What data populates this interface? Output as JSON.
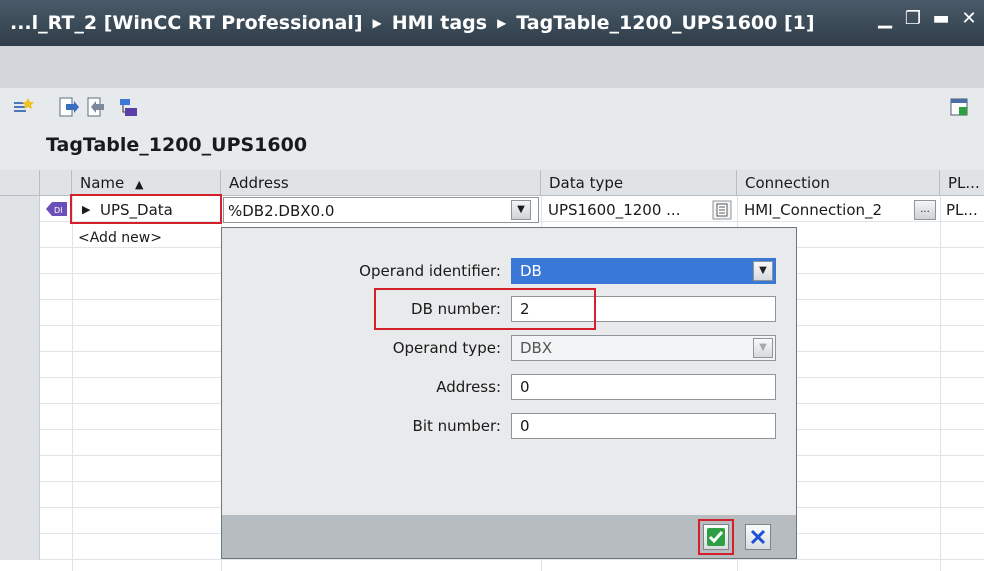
{
  "title_bar": {
    "crumbs": [
      "...l_RT_2 [WinCC RT Professional]",
      "HMI tags",
      "TagTable_1200_UPS1600 [1]"
    ]
  },
  "table_title": "TagTable_1200_UPS1600",
  "columns": {
    "name": "Name",
    "address": "Address",
    "data_type": "Data type",
    "connection": "Connection",
    "plc": "PL..."
  },
  "tag_row": {
    "name": "UPS_Data",
    "address": "%DB2.DBX0.0",
    "data_type": "UPS1600_1200 ...",
    "connection": "HMI_Connection_2",
    "plc": "PL...",
    "conn_button": "..."
  },
  "add_new": "<Add new>",
  "dialog": {
    "operand_identifier_label": "Operand identifier:",
    "operand_identifier_value": "DB",
    "db_number_label": "DB number:",
    "db_number_value": "2",
    "operand_type_label": "Operand type:",
    "operand_type_value": "DBX",
    "address_label": "Address:",
    "address_value": "0",
    "bit_number_label": "Bit number:",
    "bit_number_value": "0"
  },
  "colors": {
    "highlight": "#d4202a",
    "selection": "#3a78d8",
    "ok_green": "#2ea043",
    "cancel_blue": "#1f4fd6"
  }
}
